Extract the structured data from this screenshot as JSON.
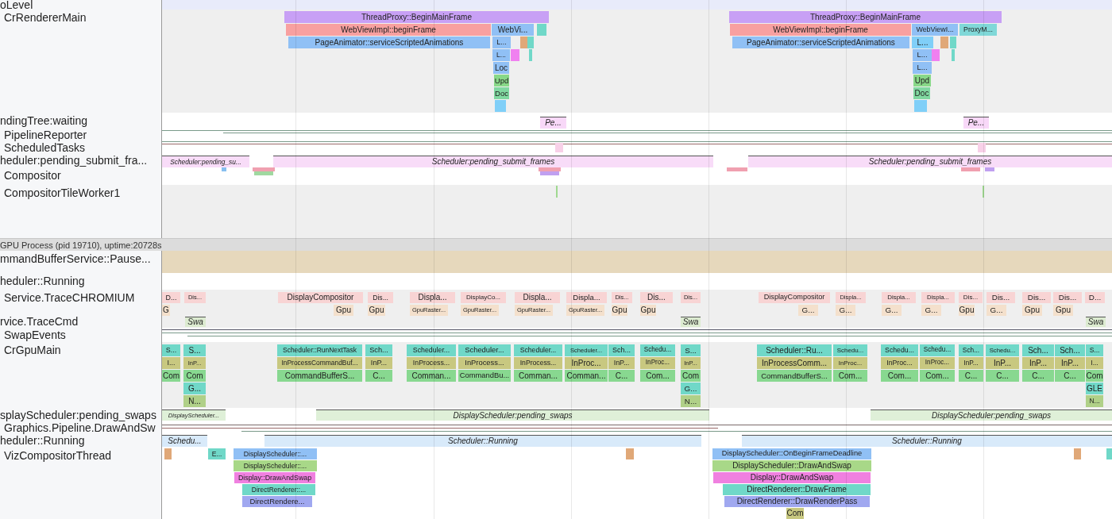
{
  "renderer_tracks": [
    {
      "label": "oLevel",
      "kind": "async"
    },
    {
      "label": "CrRendererMain",
      "kind": "thread",
      "slices": [
        {
          "label": "ThreadProxy::BeginMainFrame",
          "color": "#c8a0f5"
        },
        {
          "label": "WebViewImpl::beginFrame",
          "color": "#f8a0a0"
        },
        {
          "label": "WebVi...",
          "color": "#90c0f5"
        },
        {
          "label": "PageAnimator::serviceScriptedAnimations",
          "color": "#90c0f5"
        },
        {
          "label": "L...",
          "color": "#90c0f5"
        },
        {
          "label": "L...",
          "color": "#90c0f5"
        },
        {
          "label": "Loc",
          "color": "#90c0f5"
        },
        {
          "label": "Upd",
          "color": "#88d888"
        },
        {
          "label": "Doc",
          "color": "#80d8a0"
        },
        {
          "color": "#80cff8"
        },
        {
          "color": "#e0a878"
        },
        {
          "color": "#f080f0"
        },
        {
          "color": "#70d8c8"
        },
        {
          "color": "#70d8c8"
        },
        {
          "color": "#70d8c8"
        },
        {
          "label": "ThreadProxy::BeginMainFrame",
          "color": "#c8a0f5"
        },
        {
          "label": "WebViewImpl::beginFrame",
          "color": "#f8a0a0"
        },
        {
          "label": "WebViewI...",
          "color": "#90c0f5"
        },
        {
          "label": "ProxyM...",
          "color": "#80d8d8"
        },
        {
          "label": "PageAnimator::serviceScriptedAnimations",
          "color": "#90c0f5"
        },
        {
          "label": "L...",
          "color": "#80cff8"
        },
        {
          "label": "L...",
          "color": "#90c0f5"
        },
        {
          "label": "L...",
          "color": "#90c0f5"
        },
        {
          "label": "Upd",
          "color": "#88d888"
        },
        {
          "label": "Doc",
          "color": "#80d8a0"
        },
        {
          "color": "#80cff8"
        },
        {
          "color": "#e0a878"
        },
        {
          "color": "#f080f0"
        },
        {
          "color": "#70d8c8"
        },
        {
          "color": "#70d8c8"
        }
      ]
    },
    {
      "label": "ndingTree:waiting",
      "kind": "async",
      "slices": [
        {
          "label": "Pe...",
          "color": "#f8d8f8"
        },
        {
          "label": "Pe...",
          "color": "#f8d8f8"
        }
      ]
    },
    {
      "label": "PipelineReporter",
      "kind": "thread"
    },
    {
      "label": "ScheduledTasks",
      "kind": "thread",
      "slices": [
        {
          "color": "#f8d0e8"
        },
        {
          "color": "#f8d0e8"
        }
      ]
    },
    {
      "label": "heduler:pending_submit_fra...",
      "kind": "async",
      "slices": [
        {
          "label": "Scheduler:pending_su...",
          "color": "#f8dcf8"
        },
        {
          "label": "Scheduler:pending_submit_frames",
          "color": "#f8dcf8"
        },
        {
          "label": "Scheduler:pending_submit_frames",
          "color": "#f8dcf8"
        }
      ]
    },
    {
      "label": "Compositor",
      "kind": "thread",
      "slices": [
        {
          "color": "#88c0f0"
        },
        {
          "color": "#f0a0b0"
        },
        {
          "color": "#a0d8a0"
        },
        {
          "color": "#f0a0b0"
        },
        {
          "color": "#c0a0f0"
        },
        {
          "color": "#f0a0b0"
        },
        {
          "color": "#f0a0b0"
        },
        {
          "color": "#c0a0f0"
        }
      ]
    },
    {
      "label": "CompositorTileWorker1",
      "kind": "thread",
      "slices": [
        {
          "color": "#a0d890"
        },
        {
          "color": "#a0d890"
        }
      ]
    }
  ],
  "gpu_process": {
    "title": "GPU Process (pid 19710), uptime:20728s",
    "tracks": [
      {
        "label": "mmandBufferService::Pause...",
        "kind": "async"
      },
      {
        "label": "heduler::Running",
        "kind": "async"
      },
      {
        "label": "Service.TraceCHROMIUM",
        "kind": "thread",
        "slices": [
          {
            "label": "D...",
            "color": "#f8d4d4"
          },
          {
            "label": "Dis...",
            "color": "#f8d4d4"
          },
          {
            "label": "DisplayCompositor",
            "color": "#f8d4d4"
          },
          {
            "label": "Dis...",
            "color": "#f8d4d4"
          },
          {
            "label": "Displa...",
            "color": "#f8d4d4"
          },
          {
            "label": "DisplayCo...",
            "color": "#f8d4d4"
          },
          {
            "label": "Displa...",
            "color": "#f8d4d4"
          },
          {
            "label": "Displa...",
            "color": "#f8d4d4"
          },
          {
            "label": "Dis...",
            "color": "#f8d4d4"
          },
          {
            "label": "Dis...",
            "color": "#f8d4d4"
          },
          {
            "label": "Dis...",
            "color": "#f8d4d4"
          },
          {
            "label": "DisplayCompositor",
            "color": "#f8d4d4"
          },
          {
            "label": "Displa...",
            "color": "#f8d4d4"
          },
          {
            "label": "Displa...",
            "color": "#f8d4d4"
          },
          {
            "label": "Displa...",
            "color": "#f8d4d4"
          },
          {
            "label": "Dis...",
            "color": "#f8d4d4"
          },
          {
            "label": "Dis...",
            "color": "#f8d4d4"
          },
          {
            "label": "Dis...",
            "color": "#f8d4d4"
          },
          {
            "label": "Dis...",
            "color": "#f8d4d4"
          },
          {
            "label": "D...",
            "color": "#f8d4d4"
          },
          {
            "label": "G",
            "color": "#f4e0cc"
          },
          {
            "label": "Gpu",
            "color": "#f4e0cc"
          },
          {
            "label": "Gpu",
            "color": "#f4e0cc"
          },
          {
            "label": "GpuRaster...",
            "color": "#f4e0cc"
          },
          {
            "label": "GpuRaster...",
            "color": "#f4e0cc"
          },
          {
            "label": "GpuRaster...",
            "color": "#f4e0cc"
          },
          {
            "label": "GpuRaster...",
            "color": "#f4e0cc"
          },
          {
            "label": "Gpu",
            "color": "#f4e0cc"
          },
          {
            "label": "Gpu",
            "color": "#f4e0cc"
          },
          {
            "label": "G...",
            "color": "#f4e0cc"
          },
          {
            "label": "G...",
            "color": "#f4e0cc"
          },
          {
            "label": "G...",
            "color": "#f4e0cc"
          },
          {
            "label": "G...",
            "color": "#f4e0cc"
          },
          {
            "label": "Gpu",
            "color": "#f4e0cc"
          },
          {
            "label": "G...",
            "color": "#f4e0cc"
          },
          {
            "label": "Gpu",
            "color": "#f4e0cc"
          },
          {
            "label": "Gpu",
            "color": "#f4e0cc"
          }
        ]
      },
      {
        "label": "rvice.TraceCmd",
        "kind": "async",
        "slices": [
          {
            "label": "Swa",
            "color": "#dcebd0"
          },
          {
            "label": "Swa",
            "color": "#dcebd0"
          },
          {
            "label": "Swa",
            "color": "#dcebd0"
          }
        ]
      },
      {
        "label": "SwapEvents",
        "kind": "thread"
      },
      {
        "label": "CrGpuMain",
        "kind": "thread",
        "slices": [
          {
            "label": "S...",
            "color": "#70d8c8"
          },
          {
            "label": "I...",
            "color": "#c8c880"
          },
          {
            "label": "Com",
            "color": "#88d890"
          },
          {
            "label": "S...",
            "color": "#70d8c8"
          },
          {
            "label": "InP...",
            "color": "#c8c880"
          },
          {
            "label": "Com",
            "color": "#88d890"
          },
          {
            "label": "G...",
            "color": "#70d8c8"
          },
          {
            "label": "N...",
            "color": "#b0d088"
          },
          {
            "label": "Scheduler::RunNextTask",
            "color": "#70d8c8"
          },
          {
            "label": "InProcessCommandBuf...",
            "color": "#c8c880"
          },
          {
            "label": "CommandBufferS...",
            "color": "#88d890"
          },
          {
            "label": "Sch...",
            "color": "#70d8c8"
          },
          {
            "label": "InP...",
            "color": "#c8c880"
          },
          {
            "label": "C...",
            "color": "#88d890"
          },
          {
            "label": "Scheduler...",
            "color": "#70d8c8"
          },
          {
            "label": "InProcess...",
            "color": "#c8c880"
          },
          {
            "label": "Comman...",
            "color": "#88d890"
          },
          {
            "label": "Scheduler...",
            "color": "#70d8c8"
          },
          {
            "label": "InProcess...",
            "color": "#c8c880"
          },
          {
            "label": "CommandBu...",
            "color": "#88d890"
          },
          {
            "label": "Scheduler...",
            "color": "#70d8c8"
          },
          {
            "label": "InProcess...",
            "color": "#c8c880"
          },
          {
            "label": "Comman...",
            "color": "#88d890"
          },
          {
            "label": "Scheduler...",
            "color": "#70d8c8"
          },
          {
            "label": "InProc...",
            "color": "#c8c880"
          },
          {
            "label": "Comman...",
            "color": "#88d890"
          },
          {
            "label": "Sch...",
            "color": "#70d8c8"
          },
          {
            "label": "InP...",
            "color": "#c8c880"
          },
          {
            "label": "C...",
            "color": "#88d890"
          },
          {
            "label": "Schedu...",
            "color": "#70d8c8"
          },
          {
            "label": "InProc...",
            "color": "#c8c880"
          },
          {
            "label": "Com...",
            "color": "#88d890"
          },
          {
            "label": "S...",
            "color": "#70d8c8"
          },
          {
            "label": "InP...",
            "color": "#c8c880"
          },
          {
            "label": "Com",
            "color": "#88d890"
          },
          {
            "label": "G...",
            "color": "#70d8c8"
          },
          {
            "label": "N...",
            "color": "#b0d088"
          },
          {
            "label": "Scheduler::Ru...",
            "color": "#70d8c8"
          },
          {
            "label": "InProcessComm...",
            "color": "#c8c880"
          },
          {
            "label": "CommandBufferS...",
            "color": "#88d890"
          },
          {
            "label": "Schedu...",
            "color": "#70d8c8"
          },
          {
            "label": "InProc...",
            "color": "#c8c880"
          },
          {
            "label": "Com...",
            "color": "#88d890"
          },
          {
            "label": "Schedu...",
            "color": "#70d8c8"
          },
          {
            "label": "InProc...",
            "color": "#c8c880"
          },
          {
            "label": "Com...",
            "color": "#88d890"
          },
          {
            "label": "Schedu...",
            "color": "#70d8c8"
          },
          {
            "label": "InProc...",
            "color": "#c8c880"
          },
          {
            "label": "Com...",
            "color": "#88d890"
          },
          {
            "label": "Sch...",
            "color": "#70d8c8"
          },
          {
            "label": "InP...",
            "color": "#c8c880"
          },
          {
            "label": "C...",
            "color": "#88d890"
          },
          {
            "label": "Schedu...",
            "color": "#70d8c8"
          },
          {
            "label": "InP...",
            "color": "#c8c880"
          },
          {
            "label": "C...",
            "color": "#88d890"
          },
          {
            "label": "Sch...",
            "color": "#70d8c8"
          },
          {
            "label": "InP...",
            "color": "#c8c880"
          },
          {
            "label": "C...",
            "color": "#88d890"
          },
          {
            "label": "Sch...",
            "color": "#70d8c8"
          },
          {
            "label": "InP...",
            "color": "#c8c880"
          },
          {
            "label": "C...",
            "color": "#88d890"
          },
          {
            "label": "S...",
            "color": "#70d8c8"
          },
          {
            "label": "I...",
            "color": "#c8c880"
          },
          {
            "label": "Com",
            "color": "#88d890"
          },
          {
            "label": "GLE",
            "color": "#70d8c8"
          },
          {
            "label": "N...",
            "color": "#b0d088"
          }
        ]
      },
      {
        "label": "splayScheduler:pending_swaps",
        "kind": "async",
        "slices": [
          {
            "label": "DisplayScheduler...",
            "color": "#dff0d8"
          },
          {
            "label": "DisplayScheduler:pending_swaps",
            "color": "#dff0d8"
          },
          {
            "label": "DisplayScheduler:pending_swaps",
            "color": "#dff0d8"
          }
        ]
      },
      {
        "label": "Graphics.Pipeline.DrawAndSw",
        "kind": "thread"
      },
      {
        "label": "heduler::Running",
        "kind": "async",
        "slices": [
          {
            "label": "Schedu...",
            "color": "#d8eafa"
          },
          {
            "label": "Scheduler::Running",
            "color": "#d8eafa"
          },
          {
            "label": "Scheduler::Running",
            "color": "#d8eafa"
          }
        ]
      },
      {
        "label": "VizCompositorThread",
        "kind": "thread",
        "slices": [
          {
            "color": "#e0a878"
          },
          {
            "label": "E...",
            "color": "#70d8c8"
          },
          {
            "label": "DisplayScheduler::...",
            "color": "#90c0f5"
          },
          {
            "label": "DisplayScheduler::...",
            "color": "#a8d888"
          },
          {
            "label": "Display::DrawAndSwap",
            "color": "#f080e0"
          },
          {
            "label": "DirectRenderer::...",
            "color": "#70d8c8"
          },
          {
            "label": "DirectRendere...",
            "color": "#a0a8f0"
          },
          {
            "color": "#e0a878"
          },
          {
            "label": "DisplayScheduler::OnBeginFrameDeadline",
            "color": "#90c0f5"
          },
          {
            "label": "DisplayScheduler::DrawAndSwap",
            "color": "#a8d888"
          },
          {
            "label": "Display::DrawAndSwap",
            "color": "#f080e0"
          },
          {
            "label": "DirectRenderer::DrawFrame",
            "color": "#70d8c8"
          },
          {
            "label": "DirectRenderer::DrawRenderPass",
            "color": "#a0a8f0"
          },
          {
            "label": "Com",
            "color": "#c8c880"
          },
          {
            "color": "#e0a878"
          },
          {
            "color": "#70d8c8"
          }
        ]
      }
    ]
  }
}
